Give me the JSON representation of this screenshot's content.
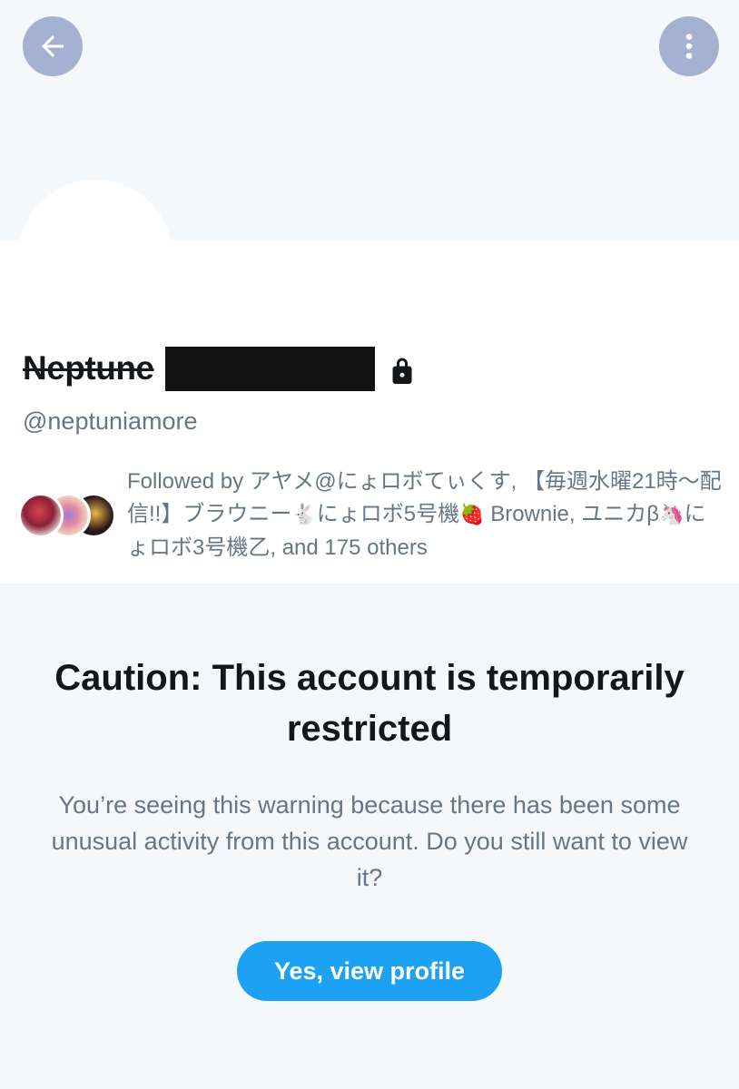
{
  "header": {
    "back_icon": "arrow-left-icon",
    "more_icon": "more-vertical-icon"
  },
  "profile": {
    "display_name": "Neptune",
    "handle": "@neptuniamore",
    "protected_icon": "lock-icon",
    "followed_by": {
      "prefix": "Followed by",
      "follower_1": "アヤメ@にょロボてぃくす,",
      "follower_2_part1": "【毎週水曜21時〜配信!!】ブラウニー",
      "follower_2_emoji": "🐇",
      "follower_2_part2": "にょロボ5号機",
      "follower_2_emoji2": "🍓",
      "follower_2_part3": "Brownie,",
      "follower_3_part1": "ユニカβ",
      "follower_3_emoji": "🦄",
      "follower_3_part2": "にょロボ3号機乙,",
      "suffix": "and 175 others"
    }
  },
  "warning": {
    "title": "Caution: This account is temporarily restricted",
    "body": "You’re seeing this warning because there has been some unusual activity from this account. Do you still want to view it?",
    "button_label": "Yes, view profile"
  },
  "colors": {
    "accent": "#1da1f2",
    "round_button": "#a4b1d0",
    "background": "#f5f8fa",
    "secondary_text": "#657786",
    "primary_text": "#14171a"
  }
}
